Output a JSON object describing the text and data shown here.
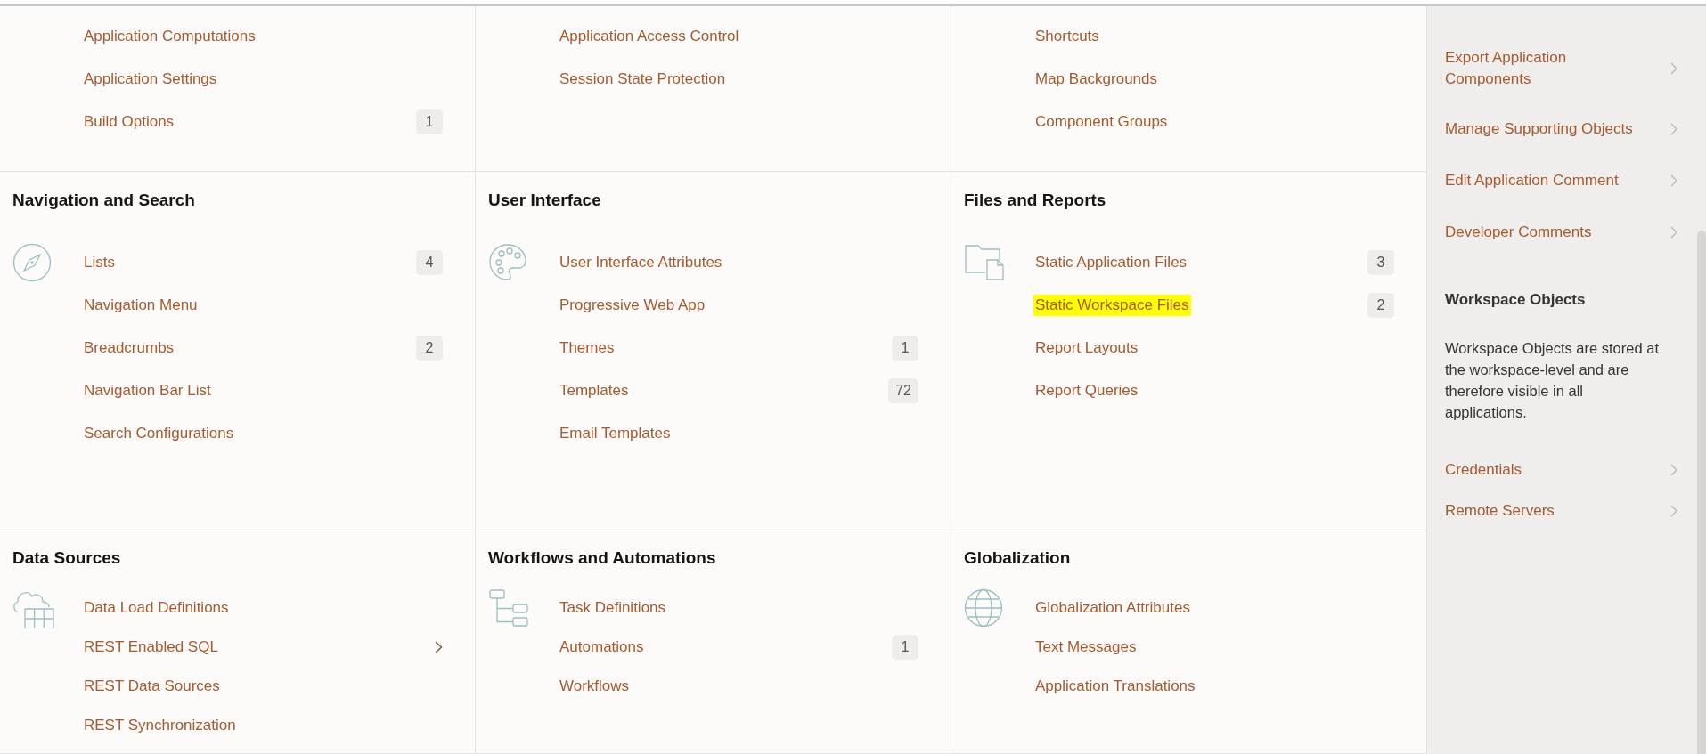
{
  "top_cards": [
    {
      "items": [
        {
          "label": "Application Computations"
        },
        {
          "label": "Application Settings"
        },
        {
          "label": "Build Options",
          "count": "1"
        }
      ]
    },
    {
      "items": [
        {
          "label": "Application Access Control"
        },
        {
          "label": "Session State Protection"
        }
      ]
    },
    {
      "items": [
        {
          "label": "Shortcuts"
        },
        {
          "label": "Map Backgrounds"
        },
        {
          "label": "Component Groups"
        }
      ]
    }
  ],
  "cards": [
    {
      "title": "Navigation and Search",
      "items": [
        {
          "label": "Lists",
          "count": "4"
        },
        {
          "label": "Navigation Menu"
        },
        {
          "label": "Breadcrumbs",
          "count": "2"
        },
        {
          "label": "Navigation Bar List"
        },
        {
          "label": "Search Configurations"
        }
      ]
    },
    {
      "title": "User Interface",
      "items": [
        {
          "label": "User Interface Attributes"
        },
        {
          "label": "Progressive Web App"
        },
        {
          "label": "Themes",
          "count": "1"
        },
        {
          "label": "Templates",
          "count": "72"
        },
        {
          "label": "Email Templates"
        }
      ]
    },
    {
      "title": "Files and Reports",
      "items": [
        {
          "label": "Static Application Files",
          "count": "3",
          "highlighted": false
        },
        {
          "label": "Static Workspace Files",
          "count": "2",
          "highlighted": true
        },
        {
          "label": "Report Layouts",
          "highlighted": false
        },
        {
          "label": "Report Queries",
          "highlighted": false
        }
      ]
    },
    {
      "title": "Data Sources",
      "items": [
        {
          "label": "Data Load Definitions",
          "kind": "link"
        },
        {
          "label": "REST Enabled SQL",
          "kind": "submenu"
        },
        {
          "label": "REST Data Sources",
          "kind": "link"
        },
        {
          "label": "REST Synchronization",
          "kind": "link"
        }
      ]
    },
    {
      "title": "Workflows and Automations",
      "items": [
        {
          "label": "Task Definitions"
        },
        {
          "label": "Automations",
          "count": "1"
        },
        {
          "label": "Workflows"
        }
      ]
    },
    {
      "title": "Globalization",
      "items": [
        {
          "label": "Globalization Attributes"
        },
        {
          "label": "Text Messages"
        },
        {
          "label": "Application Translations"
        }
      ]
    }
  ],
  "sidebar": {
    "task_items": [
      "Export Application Components",
      "Manage Supporting Objects",
      "Edit Application Comment",
      "Developer Comments"
    ],
    "workspace_heading": "Workspace Objects",
    "workspace_description": "Workspace Objects are stored at the workspace-level and are therefore visible in all applications.",
    "workspace_items": [
      "Credentials",
      "Remote Servers"
    ]
  }
}
